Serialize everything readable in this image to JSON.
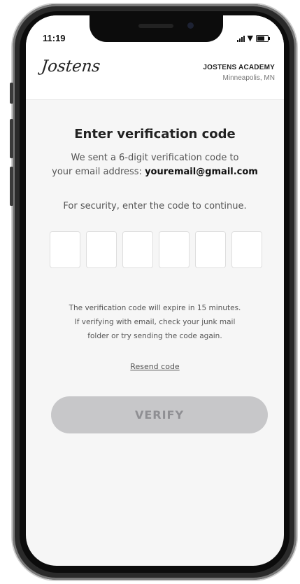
{
  "status_bar": {
    "time": "11:19"
  },
  "header": {
    "logo_text": "Jostens",
    "school_name": "JOSTENS ACADEMY",
    "school_location": "Minneapolis, MN"
  },
  "main": {
    "title": "Enter verification code",
    "sent_text_line1": "We sent a 6-digit verification code to",
    "sent_text_line2_prefix": "your email address:",
    "email": "youremail@gmail.com",
    "security_text": "For security, enter the code to continue.",
    "code_digits": [
      "",
      "",
      "",
      "",
      "",
      ""
    ],
    "expire_line1": "The verification code will expire in 15 minutes.",
    "expire_line2": "If verifying with email, check your junk mail",
    "expire_line3": "folder or try sending the code again.",
    "resend_label": "Resend code",
    "verify_label": "VERIFY"
  },
  "colors": {
    "screen_background": "#f6f6f6",
    "button_disabled": "#c7c7c9",
    "button_text": "#8f8f93"
  }
}
